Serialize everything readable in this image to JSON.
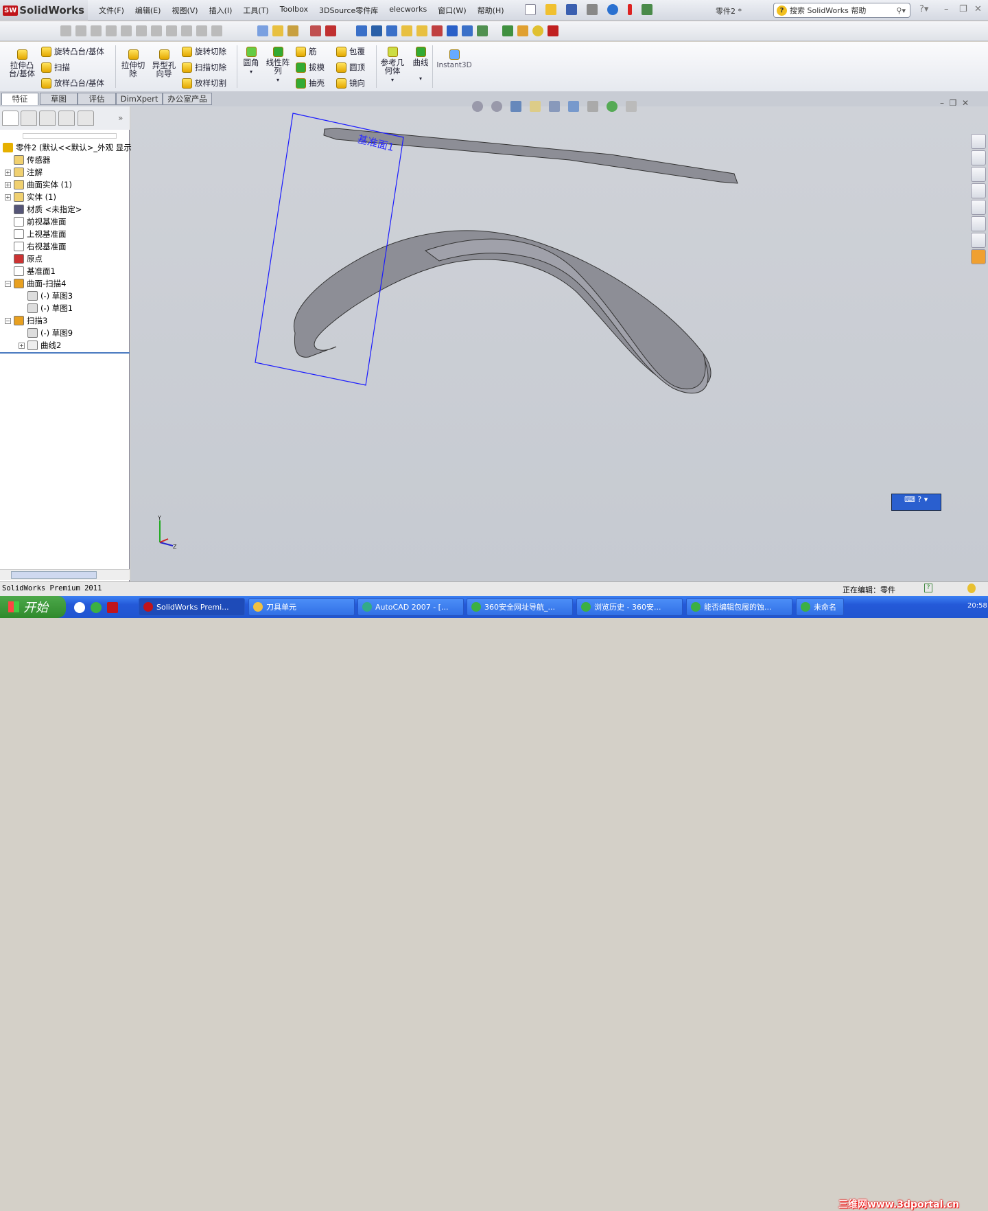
{
  "app": {
    "logo_text": "SolidWorks",
    "doc_title": "零件2 *"
  },
  "menu": [
    "文件(F)",
    "编辑(E)",
    "视图(V)",
    "插入(I)",
    "工具(T)",
    "Toolbox",
    "3DSource零件库",
    "elecworks",
    "窗口(W)",
    "帮助(H)"
  ],
  "help_search": {
    "placeholder": "搜索 SolidWorks 帮助"
  },
  "command_manager": {
    "extrude_boss": "拉伸凸台/基体",
    "revolve_boss": "旋转凸台/基体",
    "sweep": "扫描",
    "loft_boss": "放样凸台/基体",
    "extrude_cut": "拉伸切除",
    "hole_wizard": "异型孔向导",
    "revolve_cut": "旋转切除",
    "sweep_cut": "扫描切除",
    "loft_cut": "放样切割",
    "fillet": "圆角",
    "linear_pattern": "线性阵列",
    "rib": "筋",
    "draft": "拔模",
    "shell": "抽壳",
    "wrap": "包覆",
    "dome": "圆顶",
    "mirror": "镜向",
    "ref_geometry": "参考几何体",
    "curves": "曲线",
    "instant3d": "Instant3D"
  },
  "tabs": [
    {
      "label": "特征",
      "active": true
    },
    {
      "label": "草图"
    },
    {
      "label": "评估"
    },
    {
      "label": "DimXpert"
    },
    {
      "label": "办公室产品"
    }
  ],
  "feature_tree": {
    "root": "零件2  (默认<<默认>_外观 显示",
    "items": [
      {
        "label": "传感器",
        "icon": "sensor-folder-icon"
      },
      {
        "label": "注解",
        "icon": "annotation-folder-icon",
        "expand": "+"
      },
      {
        "label": "曲面实体 (1)",
        "icon": "surface-bodies-icon",
        "expand": "+"
      },
      {
        "label": "实体 (1)",
        "icon": "solid-bodies-icon",
        "expand": "+"
      },
      {
        "label": "材质 <未指定>",
        "icon": "material-icon"
      },
      {
        "label": "前视基准面",
        "icon": "plane-icon"
      },
      {
        "label": "上视基准面",
        "icon": "plane-icon"
      },
      {
        "label": "右视基准面",
        "icon": "plane-icon"
      },
      {
        "label": "原点",
        "icon": "origin-icon"
      },
      {
        "label": "基准面1",
        "icon": "plane-icon"
      },
      {
        "label": "曲面-扫描4",
        "icon": "sweep-icon",
        "expand": "−"
      },
      {
        "label": "(-)  草图3",
        "icon": "sketch-icon",
        "child": true
      },
      {
        "label": "(-)  草图1",
        "icon": "sketch-icon",
        "child": true
      },
      {
        "label": "扫描3",
        "icon": "sweep-icon",
        "expand": "−"
      },
      {
        "label": "(-)  草图9",
        "icon": "sketch-icon",
        "child": true
      },
      {
        "label": "曲线2",
        "icon": "curve-icon",
        "child": true,
        "expand": "+"
      }
    ]
  },
  "viewport": {
    "plane_label": "基准面1",
    "triad": [
      "Y",
      "Z"
    ]
  },
  "status": {
    "left": "SolidWorks Premium 2011",
    "editing": "正在编辑：零件"
  },
  "taskbar": {
    "start": "开始",
    "tasks": [
      "SolidWorks Premi...",
      "刀具单元",
      "AutoCAD 2007 - [...",
      "360安全网址导航_...",
      "浏览历史 - 360安...",
      "能否编辑包履的蚀...",
      "未命名"
    ],
    "clock": "20:58"
  },
  "watermark": "三维网www.3dportal.cn",
  "colors": {
    "accent": "#2459d8",
    "plane": "#1a1aff",
    "model": "#8d8e96"
  }
}
